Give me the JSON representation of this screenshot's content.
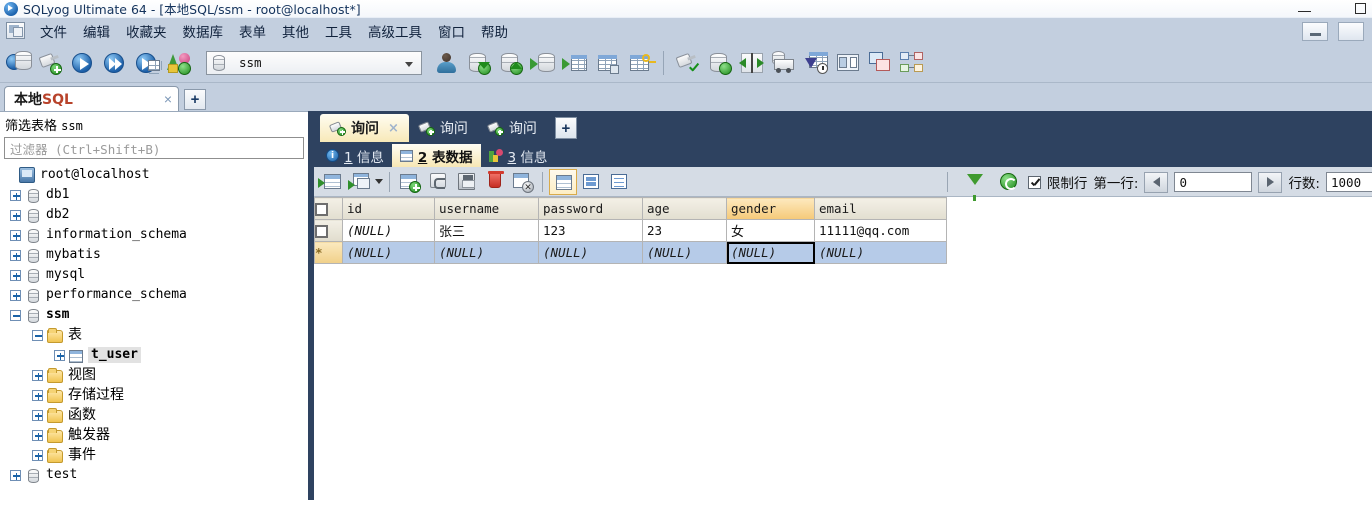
{
  "window": {
    "title": "SQLyog Ultimate 64 - [本地SQL/ssm - root@localhost*]",
    "app_icon": "sqlyog-icon",
    "minimize_label": "—",
    "maximize_label": "▢"
  },
  "menubar": {
    "items": [
      {
        "label": "文件",
        "name": "menu-file"
      },
      {
        "label": "编辑",
        "name": "menu-edit"
      },
      {
        "label": "收藏夹",
        "name": "menu-favorites"
      },
      {
        "label": "数据库",
        "name": "menu-database"
      },
      {
        "label": "表单",
        "name": "menu-table"
      },
      {
        "label": "其他",
        "name": "menu-other"
      },
      {
        "label": "工具",
        "name": "menu-tools"
      },
      {
        "label": "高级工具",
        "name": "menu-powertools"
      },
      {
        "label": "窗口",
        "name": "menu-window"
      },
      {
        "label": "帮助",
        "name": "menu-help"
      }
    ]
  },
  "toolbar": {
    "db_selector_value": "ssm",
    "icons": [
      "new-connection-icon",
      "new-query-icon",
      "execute-query-icon",
      "execute-all-queries-icon",
      "execute-query-new-tab-icon",
      "sync-objects-icon"
    ],
    "icons_right": [
      "user-manager-icon",
      "backup-database-icon",
      "restore-database-icon",
      "import-database-icon",
      "export-table-icon",
      "create-table-icon",
      "manage-index-icon",
      "schema-designer-icon",
      "sync-data-icon",
      "compare-icon",
      "migrate-icon",
      "scheduled-backup-icon",
      "query-builder-icon",
      "grid-designer-icon",
      "er-diagram-icon"
    ]
  },
  "workspace": {
    "tab_label_cn": "本地",
    "tab_label_sql": "SQL",
    "tab_close": "×",
    "add_tab": "+"
  },
  "objectbrowser": {
    "filter_label": "筛选表格",
    "filter_db": "ssm",
    "filter_placeholder": "过滤器 (Ctrl+Shift+B)",
    "tree": [
      {
        "label": "root@localhost",
        "icon": "server-icon",
        "indent": 0,
        "expander": "none",
        "bold": false,
        "cn": false
      },
      {
        "label": "db1",
        "icon": "database-icon",
        "indent": 1,
        "expander": "plus",
        "bold": false,
        "cn": false
      },
      {
        "label": "db2",
        "icon": "database-icon",
        "indent": 1,
        "expander": "plus",
        "bold": false,
        "cn": false
      },
      {
        "label": "information_schema",
        "icon": "database-icon",
        "indent": 1,
        "expander": "plus",
        "bold": false,
        "cn": false
      },
      {
        "label": "mybatis",
        "icon": "database-icon",
        "indent": 1,
        "expander": "plus",
        "bold": false,
        "cn": false
      },
      {
        "label": "mysql",
        "icon": "database-icon",
        "indent": 1,
        "expander": "plus",
        "bold": false,
        "cn": false
      },
      {
        "label": "performance_schema",
        "icon": "database-icon",
        "indent": 1,
        "expander": "plus",
        "bold": false,
        "cn": false
      },
      {
        "label": "ssm",
        "icon": "database-icon",
        "indent": 1,
        "expander": "minus",
        "bold": true,
        "cn": false
      },
      {
        "label": "表",
        "icon": "folder-icon",
        "indent": 2,
        "expander": "minus",
        "bold": false,
        "cn": true
      },
      {
        "label": "t_user",
        "icon": "table-icon",
        "indent": 3,
        "expander": "plus",
        "bold": true,
        "cn": false,
        "selected": true
      },
      {
        "label": "视图",
        "icon": "folder-icon",
        "indent": 2,
        "expander": "plus",
        "bold": false,
        "cn": true
      },
      {
        "label": "存储过程",
        "icon": "folder-icon",
        "indent": 2,
        "expander": "plus",
        "bold": false,
        "cn": true
      },
      {
        "label": "函数",
        "icon": "folder-icon",
        "indent": 2,
        "expander": "plus",
        "bold": false,
        "cn": true
      },
      {
        "label": "触发器",
        "icon": "folder-icon",
        "indent": 2,
        "expander": "plus",
        "bold": false,
        "cn": true
      },
      {
        "label": "事件",
        "icon": "folder-icon",
        "indent": 2,
        "expander": "plus",
        "bold": false,
        "cn": true
      },
      {
        "label": "test",
        "icon": "database-icon",
        "indent": 1,
        "expander": "plus",
        "bold": false,
        "cn": false
      }
    ]
  },
  "query_tabs": {
    "tabs": [
      {
        "label": "询问",
        "active": true,
        "close": "×"
      },
      {
        "label": "询问",
        "active": false
      },
      {
        "label": "询问",
        "active": false
      }
    ],
    "add": "+"
  },
  "result_tabs": [
    {
      "num": "1",
      "label": "信息",
      "icon": "info-icon",
      "active": false
    },
    {
      "num": "2",
      "label": "表数据",
      "icon": "grid-icon",
      "active": true
    },
    {
      "num": "3",
      "label": "信息",
      "icon": "chart-icon",
      "active": false
    }
  ],
  "data_toolbar": {
    "icons": [
      "export-grid-icon",
      "open-in-window-icon",
      "add-row-icon",
      "refresh-data-icon",
      "save-changes-icon",
      "delete-row-icon",
      "discard-changes-icon"
    ],
    "view_modes": [
      {
        "name": "grid-view-icon",
        "active": true
      },
      {
        "name": "form-view-icon",
        "active": false
      },
      {
        "name": "text-view-icon",
        "active": false
      }
    ],
    "filter_icon": "filter-icon",
    "refresh_icon": "refresh-icon",
    "limit_rows_label": "限制行",
    "limit_rows_checked": true,
    "first_row_label": "第一行:",
    "first_row_value": "0",
    "row_count_label": "行数:",
    "row_count_value": "1000",
    "prev_arrow": "◀",
    "next_arrow": "▶"
  },
  "grid": {
    "columns": [
      "id",
      "username",
      "password",
      "age",
      "gender",
      "email"
    ],
    "highlighted_column": "gender",
    "null_text": "(NULL)",
    "new_row_marker": "*",
    "rows": [
      {
        "selected": false,
        "cells": [
          "(NULL)",
          "张三",
          "123",
          "23",
          "女",
          "11111@qq.com"
        ]
      },
      {
        "selected": true,
        "new_row": true,
        "cells": [
          "(NULL)",
          "(NULL)",
          "(NULL)",
          "(NULL)",
          "(NULL)",
          "(NULL)"
        ],
        "focused_cell": "gender"
      }
    ]
  },
  "colors": {
    "menubar_bg": "#c3cfdf",
    "tabstrip_dark": "#2e4260",
    "active_tab": "#f8e9b8",
    "header_highlight": "#f5c978",
    "selected_row": "#b6cbe8",
    "splitter": "#2e4260"
  }
}
